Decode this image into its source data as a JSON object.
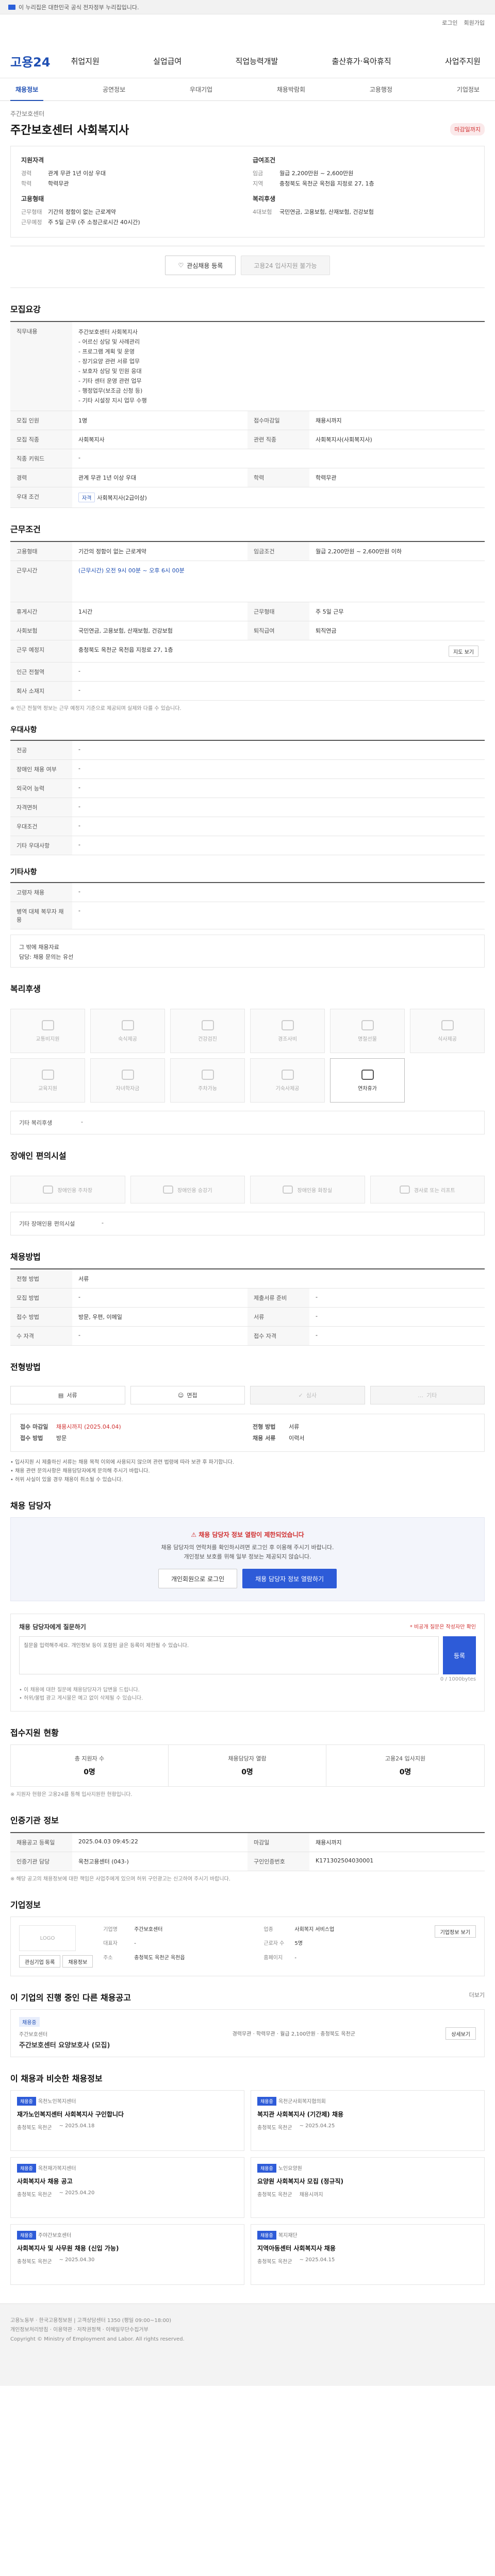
{
  "gov_banner": "이 누리집은 대한민국 공식 전자정부 누리집입니다.",
  "util": {
    "login": "로그인",
    "join": "회원가입"
  },
  "header": {
    "logo": "고용24",
    "menus": [
      "취업지원",
      "실업급여",
      "직업능력개발",
      "출산휴가·육아휴직",
      "사업주지원"
    ]
  },
  "subnav": [
    "채용정보",
    "공연정보",
    "우대기업",
    "채용박람회",
    "고용행정",
    "기업정보"
  ],
  "job": {
    "company": "주간보호센터",
    "title": "주간보호센터 사회복지사",
    "dday": "마감일까지",
    "summary": {
      "h_apply": "지원자격",
      "apply": [
        {
          "k": "경력",
          "v": "관계 무관 1년 이상 우대"
        },
        {
          "k": "학력",
          "v": "학력무관"
        }
      ],
      "h_cond": "고용형태",
      "cond": [
        {
          "k": "근무형태",
          "v": "기간의 정함이 없는 근로계약"
        },
        {
          "k": "근무예정",
          "v": "주 5일 근무 (주 소정근로시간 40시간)"
        }
      ],
      "h_pay": "급여조건",
      "pay": [
        {
          "k": "임금",
          "v": "월급 2,200만원 ~ 2,600만원"
        },
        {
          "k": "지역",
          "v": "충청북도 옥천군 옥천읍 지정로 27, 1층"
        }
      ],
      "h_period": "복리후생",
      "period": [
        {
          "k": "4대보험",
          "v": "국민연금, 고용보험, 산재보험, 건강보험"
        }
      ]
    },
    "btn_interest": "관심채용 등록",
    "btn_apply": "고용24 입사지원 불가능"
  },
  "sec_recruit": {
    "title": "모집요강",
    "duty_k": "직무내용",
    "duty": "주간보호센터 사회복지사\n- 어르신 상담 및 사례관리\n- 프로그램 계획 및 운영\n- 장기요양 관련 서류 업무\n- 보호자 상담 및 민원 응대\n- 기타 센터 운영 관련 업무\n- 행정업무(보조금 신청 등)\n- 기타 시설장 지시 업무 수행",
    "rows": [
      {
        "k": "모집 인원",
        "v": "1명",
        "k2": "접수마감일",
        "v2": "채용시까지"
      },
      {
        "k": "모집 직종",
        "v": "사회복지사",
        "k2": "관련 직종",
        "v2": "사회복지사(사회복지사)"
      },
      {
        "k": "직종 키워드",
        "v": "-",
        "k2": "",
        "v2": ""
      },
      {
        "k": "경력",
        "v": "관계 무관 1년 이상 우대",
        "k2": "학력",
        "v2": "학력무관"
      }
    ],
    "pref_k": "우대 조건",
    "pref_tag": "자격",
    "pref": "사회복지사(2급이상)"
  },
  "sec_work": {
    "title": "근무조건",
    "rows": [
      {
        "k": "고용형태",
        "v": "기간의 정함이 없는 근로계약",
        "k2": "임금조건",
        "v2": "월급 2,200만원 ~ 2,600만원 이하"
      },
      {
        "k": "근무시간",
        "v": "(근무시간) 오전 9시 00분 ~ 오후 6시 00분",
        "k2": "",
        "v2": ""
      },
      {
        "k": "휴게시간",
        "v": "1시간",
        "k2": "근무형태",
        "v2": "주 5일 근무"
      },
      {
        "k": "사회보험",
        "v": "국민연금, 고용보험, 산재보험, 건강보험",
        "k2": "퇴직급여",
        "v2": "퇴직연금"
      },
      {
        "k": "근무 예정지",
        "v": "충청북도 옥천군 옥천읍 지정로 27, 1층",
        "k2": "",
        "v2": ""
      },
      {
        "k": "인근 전철역",
        "v": "-",
        "k2": "",
        "v2": ""
      },
      {
        "k": "회사 소재지",
        "v": "-",
        "k2": "",
        "v2": ""
      }
    ],
    "map_btn": "지도 보기",
    "note": "※ 인근 전철역 정보는 근무 예정지 기준으로 제공되며 실제와 다를 수 있습니다."
  },
  "sec_pref": {
    "title": "우대사항",
    "rows": [
      {
        "k": "전공",
        "v": "-"
      },
      {
        "k": "장애인 채용 여부",
        "v": "-"
      },
      {
        "k": "외국어 능력",
        "v": "-"
      },
      {
        "k": "자격면허",
        "v": "-"
      },
      {
        "k": "우대조건",
        "v": "-"
      },
      {
        "k": "기타 우대사항",
        "v": "-"
      }
    ]
  },
  "sec_etc": {
    "title": "기타사항",
    "rows": [
      {
        "k": "고령자 채용",
        "v": "-"
      },
      {
        "k": "병역 대체 복무자 채용",
        "v": "-"
      }
    ],
    "extra": "그 밖에 채용자료\n담당: 채용 문의는 유선"
  },
  "sec_welfare": {
    "title": "복리후생",
    "items": [
      "교통비지원",
      "숙식제공",
      "건강검진",
      "경조사비",
      "명절선물",
      "식사제공",
      "교육지원",
      "자녀학자금",
      "주차가능",
      "기숙사제공",
      "연차휴가",
      "휴게시설"
    ],
    "other_k": "기타 복리후생",
    "other_v": "-"
  },
  "sec_facility": {
    "title": "장애인 편의시설",
    "items": [
      "장애인용 주차장",
      "장애인용 승강기",
      "장애인용 화장실",
      "경사로 또는 리프트"
    ],
    "other_k": "기타 장애인용 편의시설",
    "other_v": "-"
  },
  "sec_method": {
    "title": "채용방법",
    "rows": [
      {
        "k": "전형 방법",
        "v": "서류",
        "k2": "",
        "v2": ""
      },
      {
        "k": "모집 방법",
        "v": "-",
        "k2": "제출서류 준비",
        "v2": "-"
      },
      {
        "k": "접수 방법",
        "v": "방문, 우편, 이메일",
        "k2": "서류",
        "v2": "-"
      },
      {
        "k": "수 자격",
        "v": "-",
        "k2": "접수 자격",
        "v2": "-"
      }
    ]
  },
  "sec_process": {
    "title": "전형방법",
    "steps": [
      "서류",
      "면접",
      "심사",
      "기타"
    ],
    "k1": "접수 마감일",
    "v1": "채용시까지 (2025.04.04)",
    "k2": "접수 방법",
    "v2": "방문",
    "k3": "전형 방법",
    "v3": "서류",
    "k4": "채용 서류",
    "v4": "이력서",
    "bullets": "• 입사지원 시 제출하신 서류는 채용 목적 이외에 사용되지 않으며 관련 법령에 따라 보관 후 파기합니다.\n• 채용 관련 문의사항은 채용담당자에게 문의해 주시기 바랍니다.\n• 허위 사실이 있을 경우 채용이 취소될 수 있습니다."
  },
  "sec_contact": {
    "title": "채용 담당자",
    "alert": "채용 담당자 정보 열람이 제한되었습니다",
    "msg": "채용 담당자의 연락처를 확인하시려면 로그인 후 이용해 주시기 바랍니다.\n개인정보 보호를 위해 일부 정보는 제공되지 않습니다.",
    "btn1": "개인회원으로 로그인",
    "btn2": "채용 담당자 정보 열람하기"
  },
  "sec_ask": {
    "title": "채용 담당자에게 질문하기",
    "right": "* 비공개 질문은 작성자만 확인",
    "placeholder": "질문을 입력해주세요. 개인정보 등이 포함된 글은 등록이 제한될 수 있습니다.",
    "submit": "등록",
    "count": "0 / 1000bytes",
    "notes": "• 이 채용에 대한 질문에 채용담당자가 답변을 드립니다.\n• 허위/불법 광고 게시물은 예고 없이 삭제될 수 있습니다."
  },
  "sec_status": {
    "title": "접수지원 현황",
    "items": [
      {
        "k": "총 지원자 수",
        "v": "0명"
      },
      {
        "k": "채용담당자 열람",
        "v": "0명"
      },
      {
        "k": "고용24 입사지원",
        "v": "0명"
      }
    ],
    "note": "※ 지원자 현황은 고용24를 통해 입사지원한 현황입니다."
  },
  "sec_info": {
    "title": "인증기관 정보",
    "rows": [
      {
        "k": "채용공고 등록일",
        "v": "2025.04.03 09:45:22",
        "k2": "마감일",
        "v2": "채용시까지"
      },
      {
        "k": "인증기관 담당",
        "v": "옥천고용센터 (043-)",
        "k2": "구인인증번호",
        "v2": "K171302504030001"
      }
    ],
    "note": "※ 해당 공고의 채용정보에 대한 책임은 사업주에게 있으며 허위 구인광고는 신고하여 주시기 바랍니다."
  },
  "sec_company": {
    "title": "기업정보",
    "logo": "LOGO",
    "grid": [
      {
        "k": "기업명",
        "v": "주간보호센터",
        "k2": "업종",
        "v2": "사회복지 서비스업"
      },
      {
        "k": "대표자",
        "v": "-",
        "k2": "근로자 수",
        "v2": "5명"
      },
      {
        "k": "주소",
        "v": "충청북도 옥천군 옥천읍",
        "k2": "홈페이지",
        "v2": "-"
      }
    ],
    "btn": "기업정보 보기",
    "b1": "관심기업 등록",
    "b2": "채용정보"
  },
  "sec_same": {
    "title": "이 기업의 진행 중인 다른 채용공고",
    "more": "더보기",
    "badge": "채용중",
    "co": "주간보호센터",
    "ttl": "주간보호센터 요양보호사 (모집)",
    "meta": "경력무관 · 학력무관 · 월급 2,100만원 · 충청북도 옥천군",
    "btn": "상세보기"
  },
  "sec_recom": {
    "title": "이 채용과 비슷한 채용정보",
    "cards": [
      {
        "badge": "채용중",
        "co": "옥천노인복지센터",
        "ttl": "재가노인복지센터 사회복지사 구인합니다",
        "loc": "충청북도 옥천군",
        "date": "~ 2025.04.18"
      },
      {
        "badge": "채용중",
        "co": "옥천군사회복지협의회",
        "ttl": "복지관 사회복지사 (기간제) 채용",
        "loc": "충청북도 옥천군",
        "date": "~ 2025.04.25"
      },
      {
        "badge": "채용중",
        "co": "옥천재가복지센터",
        "ttl": "사회복지사 채용 공고",
        "loc": "충청북도 옥천군",
        "date": "~ 2025.04.20"
      },
      {
        "badge": "채용중",
        "co": "노인요양원",
        "ttl": "요양원 사회복지사 모집 (정규직)",
        "loc": "충청북도 옥천군",
        "date": "채용시까지"
      },
      {
        "badge": "채용중",
        "co": "주야간보호센터",
        "ttl": "사회복지사 및 사무원 채용 (신입 가능)",
        "loc": "충청북도 옥천군",
        "date": "~ 2025.04.30"
      },
      {
        "badge": "채용중",
        "co": "복지재단",
        "ttl": "지역아동센터 사회복지사 채용",
        "loc": "충청북도 옥천군",
        "date": "~ 2025.04.15"
      }
    ]
  },
  "footer": "고용노동부 · 한국고용정보원  |  고객상담센터 1350 (평일 09:00~18:00)\n개인정보처리방침 · 이용약관 · 저작권정책 · 이메일무단수집거부\nCopyright © Ministry of Employment and Labor. All rights reserved."
}
